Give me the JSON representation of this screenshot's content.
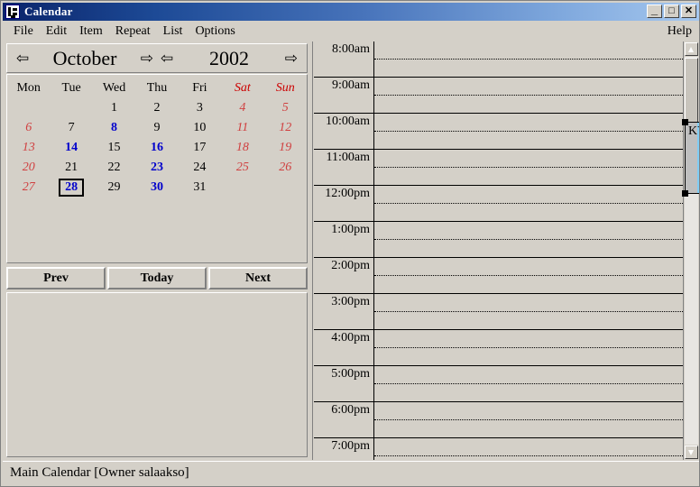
{
  "window": {
    "title": "Calendar",
    "icon": "calendar-app-icon",
    "controls": {
      "minimize": "_",
      "maximize": "□",
      "close": "✕"
    }
  },
  "menubar": {
    "items": [
      {
        "label": "File"
      },
      {
        "label": "Edit"
      },
      {
        "label": "Item"
      },
      {
        "label": "Repeat"
      },
      {
        "label": "List"
      },
      {
        "label": "Options"
      }
    ],
    "help_label": "Help"
  },
  "month_panel": {
    "prev_month_arrow": "⇦",
    "next_month_arrow": "⇨",
    "prev_year_arrow": "⇦",
    "next_year_arrow": "⇨",
    "month": "October",
    "year": "2002",
    "weekday_headers": [
      "Mon",
      "Tue",
      "Wed",
      "Thu",
      "Fri",
      "Sat",
      "Sun"
    ],
    "weeks": [
      [
        {
          "d": ""
        },
        {
          "d": ""
        },
        {
          "d": "1"
        },
        {
          "d": "2"
        },
        {
          "d": "3"
        },
        {
          "d": "4"
        },
        {
          "d": "5",
          "weekend": true
        }
      ],
      [
        {
          "d": "6",
          "weekend": true
        }
      ],
      [
        {
          "d": "7"
        },
        {
          "d": "8",
          "marked": true
        },
        {
          "d": "9"
        },
        {
          "d": "10"
        },
        {
          "d": "11"
        },
        {
          "d": "12",
          "weekend": true
        },
        {
          "d": "13",
          "weekend": true
        }
      ],
      [
        {
          "d": "14",
          "marked": true
        },
        {
          "d": "15"
        },
        {
          "d": "16",
          "marked": true
        },
        {
          "d": "17"
        },
        {
          "d": "18"
        },
        {
          "d": "19",
          "weekend": true
        },
        {
          "d": "20",
          "weekend": true
        }
      ],
      [
        {
          "d": "21"
        },
        {
          "d": "22"
        },
        {
          "d": "23",
          "marked": true
        },
        {
          "d": "24"
        },
        {
          "d": "25"
        },
        {
          "d": "26",
          "weekend": true
        },
        {
          "d": "27",
          "weekend": true
        }
      ],
      [
        {
          "d": "28",
          "marked": true,
          "selected": true
        },
        {
          "d": "29"
        },
        {
          "d": "30",
          "marked": true
        },
        {
          "d": "31"
        },
        {
          "d": ""
        },
        {
          "d": ""
        },
        {
          "d": ""
        }
      ]
    ],
    "buttons": [
      {
        "label": "Prev"
      },
      {
        "label": "Today"
      },
      {
        "label": "Next"
      }
    ]
  },
  "day_view": {
    "hours": [
      "8:00am",
      "9:00am",
      "10:00am",
      "11:00am",
      "12:00pm",
      "1:00pm",
      "2:00pm",
      "3:00pm",
      "4:00pm",
      "5:00pm",
      "6:00pm",
      "7:00pm"
    ],
    "appointment": {
      "text": "KY SysOpenin demo",
      "start": "9:00am",
      "end": "11:00am",
      "fill_color": "#7fcdf5",
      "selected": true,
      "editing": true
    },
    "scrollbar": {
      "up_arrow": "▲",
      "down_arrow": "▼"
    }
  },
  "statusbar": {
    "text": "Main Calendar [Owner salaakso]"
  },
  "colors": {
    "window_face": "#d4d0c8",
    "title_start": "#0a246a",
    "title_end": "#a6c8ef",
    "weekend": "#cc0000",
    "marked_day": "#0000cc",
    "appointment": "#7fcdf5"
  }
}
